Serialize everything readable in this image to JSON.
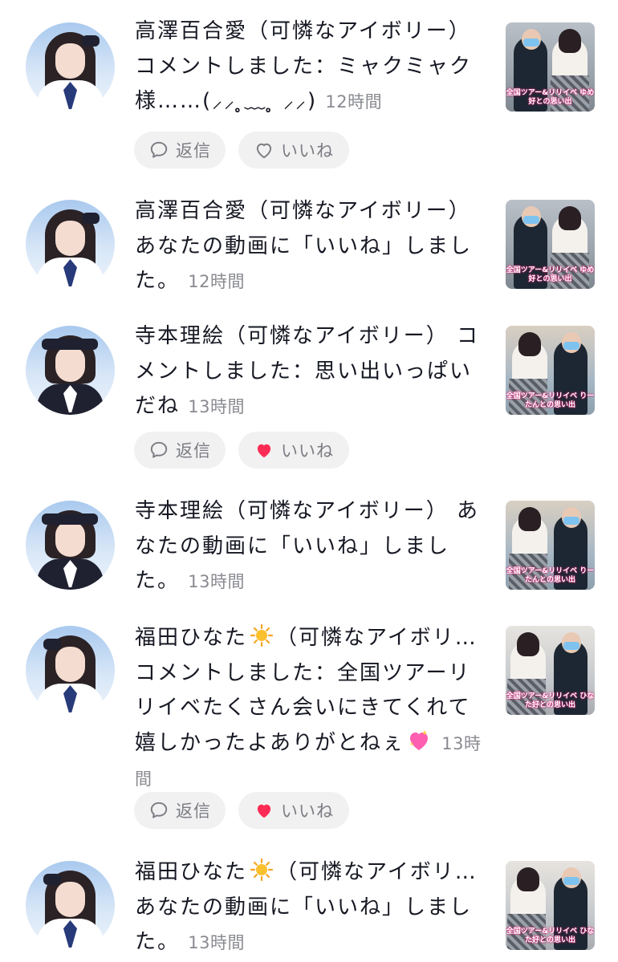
{
  "colors": {
    "heart_liked": "#fe2c55",
    "button_bg": "#f1f1f2",
    "time_text": "#8a8b91"
  },
  "notifications": [
    {
      "line1": "高澤百合愛（可憐なアイボリー）",
      "body": "コメントしました：ミャクミャク様……(⸝⸝ ̥̥﹏ ̥̥ ⸝⸝) ",
      "time": "12時間",
      "thumb_caption": "全国ツアー&リリイベ ゆめ好との思い出",
      "reply_label": "返信",
      "like_label": "いいね",
      "liked": false
    },
    {
      "line1": "高澤百合愛（可憐なアイボリー）",
      "body": "あなたの動画に「いいね」しました。 ",
      "time": "12時間",
      "thumb_caption": "全国ツアー&リリイベ ゆめ好との思い出"
    },
    {
      "line1": "寺本理絵（可憐なアイボリー） コ",
      "body": "メントしました：思い出いっぱいだね ",
      "time": "13時間",
      "thumb_caption": "全国ツアー&リリイベ りーたんとの思い出",
      "reply_label": "返信",
      "like_label": "いいね",
      "liked": true
    },
    {
      "line1": "寺本理絵（可憐なアイボリー） あ",
      "body": "なたの動画に「いいね」しました。 ",
      "time": "13時間",
      "thumb_caption": "全国ツアー&リリイベ りーたんとの思い出"
    },
    {
      "name": "福田ひなた",
      "name_suffix": "（可憐なアイボリ…",
      "body": "コメントしました：全国ツアーリリイベたくさん会いにきてくれて嬉しかったよありがとねぇ",
      "time": "13時間",
      "name_emoji": "sun-emoji",
      "body_emoji": "sparkling-heart-emoji",
      "thumb_caption": "全国ツアー&リリイベ ひなた好との思い出",
      "reply_label": "返信",
      "like_label": "いいね",
      "liked": true
    },
    {
      "name": "福田ひなた",
      "name_suffix": "（可憐なアイボリ…",
      "body": "あなたの動画に「いいね」しました。 ",
      "time": "13時間",
      "name_emoji": "sun-emoji",
      "thumb_caption": "全国ツアー&リリイベ ひなた好との思い出"
    }
  ]
}
